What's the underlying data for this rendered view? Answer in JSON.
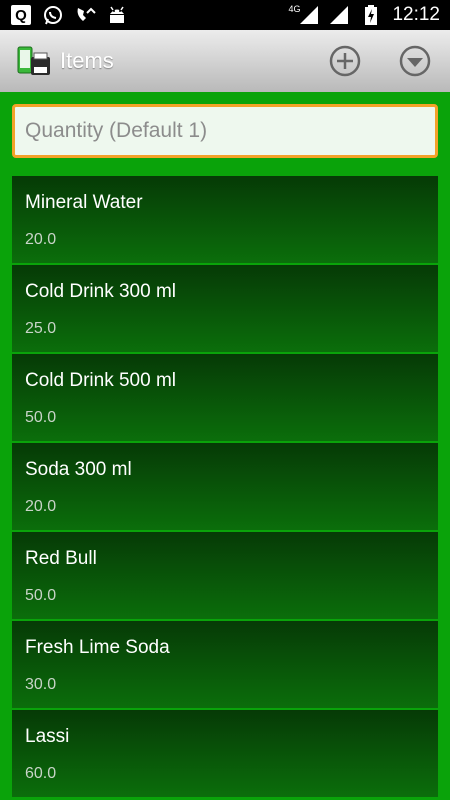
{
  "statusbar": {
    "time": "12:12",
    "network": "4G",
    "left_icons": [
      "q-app-icon",
      "whatsapp-icon",
      "missed-call-icon",
      "android-debug-icon"
    ],
    "right_icons": [
      "signal-4g-icon",
      "signal-icon",
      "battery-charging-icon"
    ]
  },
  "actionbar": {
    "title": "Items",
    "add_icon": "add-circle-icon",
    "more_icon": "dropdown-circle-icon"
  },
  "quantity": {
    "placeholder": "Quantity (Default 1)",
    "value": ""
  },
  "items": [
    {
      "name": "Mineral Water",
      "price": "20.0"
    },
    {
      "name": "Cold Drink 300 ml",
      "price": "25.0"
    },
    {
      "name": "Cold Drink 500 ml",
      "price": "50.0"
    },
    {
      "name": "Soda 300 ml",
      "price": "20.0"
    },
    {
      "name": "Red Bull",
      "price": "50.0"
    },
    {
      "name": "Fresh Lime Soda",
      "price": "30.0"
    },
    {
      "name": "Lassi",
      "price": "60.0"
    }
  ],
  "colors": {
    "background": "#0aa30a",
    "item_top": "#063a06",
    "item_bottom": "#0b6e0b",
    "input_border": "#f3a228"
  }
}
